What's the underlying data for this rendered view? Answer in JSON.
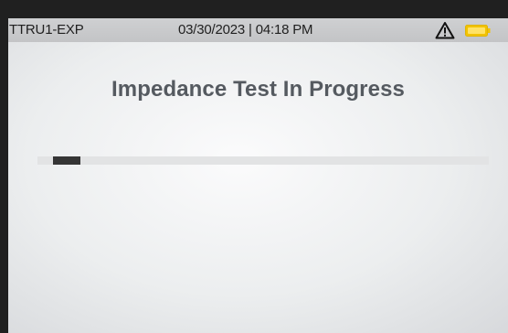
{
  "status_bar": {
    "device_id": "TTRU1-EXP",
    "datetime": "03/30/2023 | 04:18 PM",
    "warning_icon": "warning-triangle-icon",
    "battery_icon": "battery-icon",
    "battery_color": "#f2c300"
  },
  "main": {
    "title": "Impedance Test  In Progress",
    "progress_fraction": 0.06
  }
}
